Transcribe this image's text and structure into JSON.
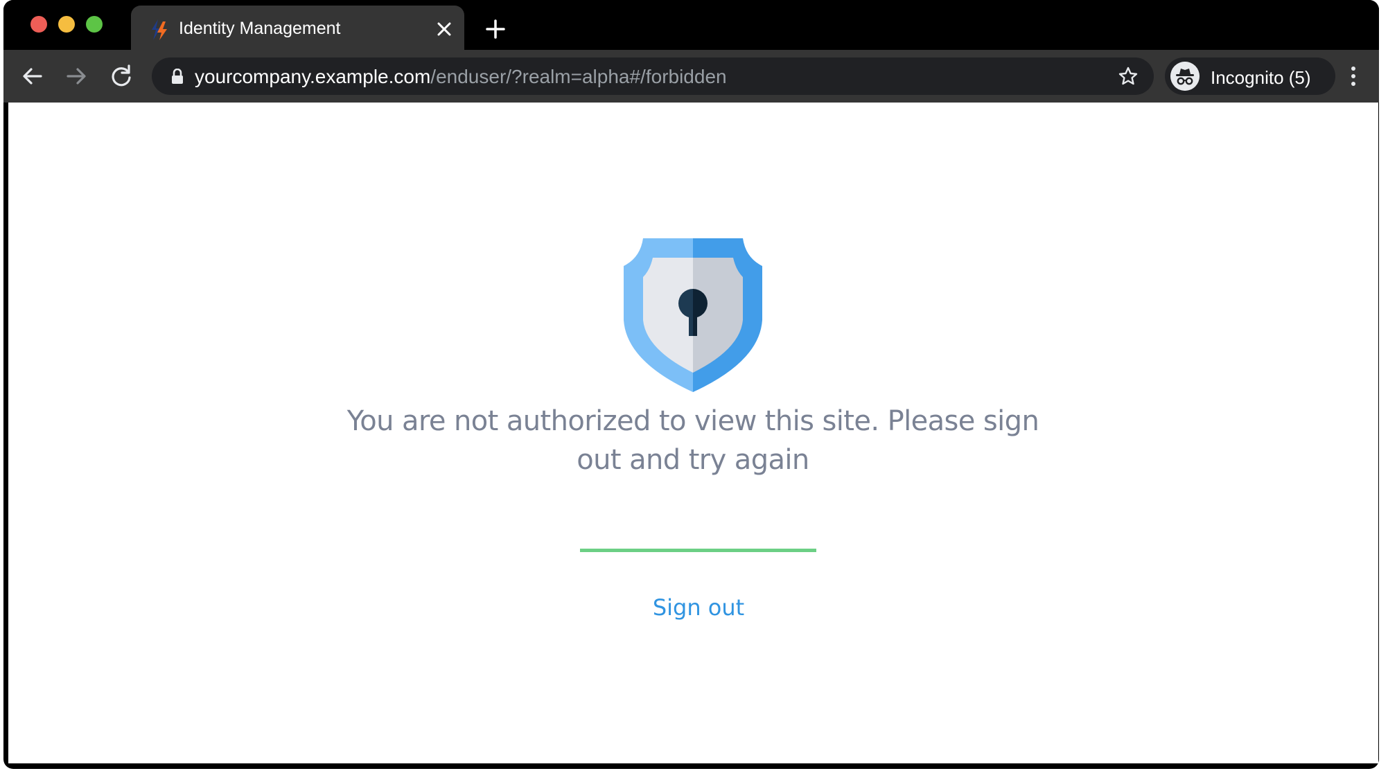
{
  "browser": {
    "tab": {
      "title": "Identity Management",
      "favicon": "forgerock-logo-icon"
    },
    "address_bar": {
      "host": "yourcompany.example.com",
      "path": "/enduser/?realm=alpha#/forbidden"
    },
    "profile": {
      "label": "Incognito (5)",
      "icon": "incognito-icon"
    }
  },
  "page": {
    "icon": "shield-keyhole-icon",
    "message": "You are not authorized to view this site. Please sign out and try again",
    "signout_label": "Sign out"
  },
  "colors": {
    "accent_link": "#3094e1",
    "divider": "#6ccf85",
    "message_text": "#7a8294",
    "shield_light": "#7cbff7",
    "shield_dark": "#429de9"
  }
}
